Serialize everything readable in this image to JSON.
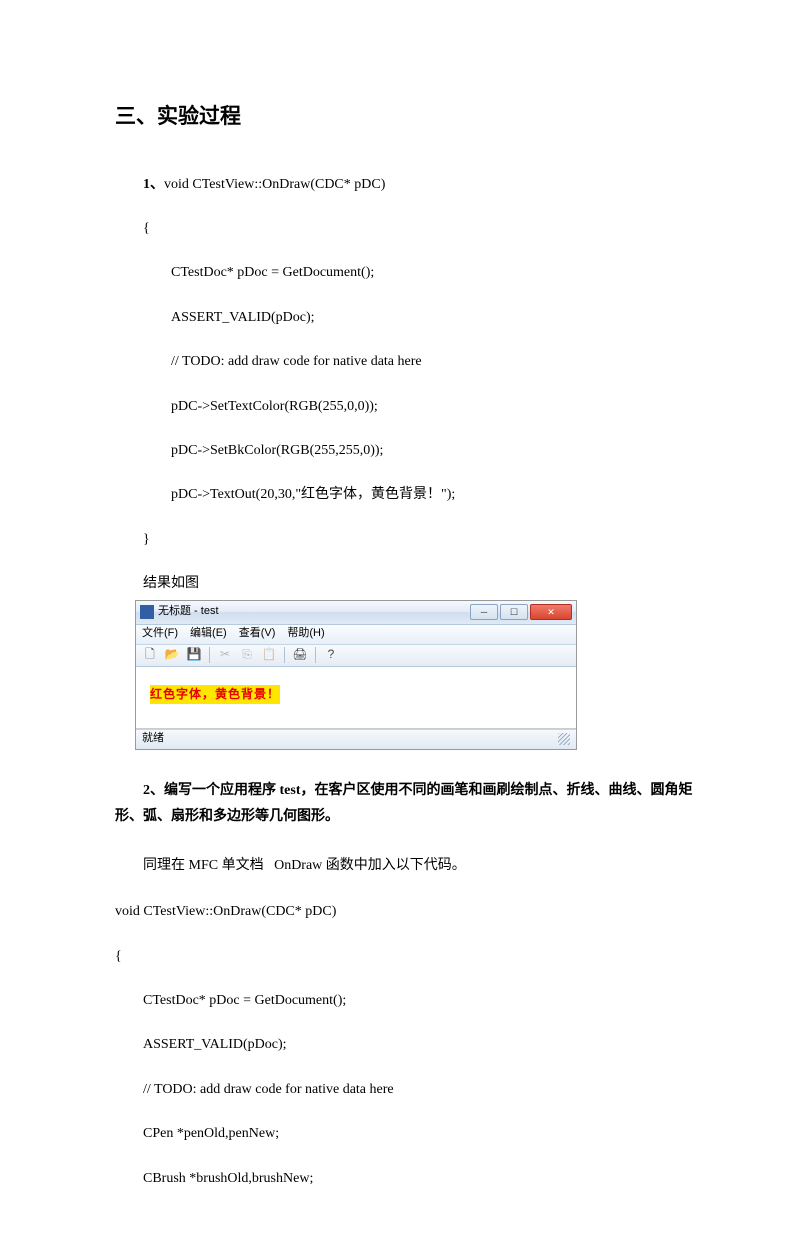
{
  "heading": "三、实验过程",
  "sec1": {
    "label": "1、",
    "sig": "void CTestView::OnDraw(CDC* pDC)",
    "open": "{",
    "l1": "CTestDoc* pDoc = GetDocument();",
    "l2": "ASSERT_VALID(pDoc);",
    "l3": "// TODO: add draw code for native data here",
    "l4": "pDC->SetTextColor(RGB(255,0,0));",
    "l5": "pDC->SetBkColor(RGB(255,255,0));",
    "l6": "pDC->TextOut(20,30,\"红色字体，黄色背景！\");",
    "close": "}",
    "result": "结果如图"
  },
  "win": {
    "title": "无标题 - test",
    "menus": {
      "file": "文件(F)",
      "edit": "编辑(E)",
      "view": "查看(V)",
      "help": "帮助(H)"
    },
    "output": "红色字体，黄色背景！",
    "status": "就绪"
  },
  "sec2": {
    "label": "2、",
    "desc": "编写一个应用程序 test，在客户区使用不同的画笔和画刷绘制点、折线、曲线、圆角矩形、弧、扇形和多边形等几何图形。",
    "note_prefix": "同理在 MFC 单文档",
    "note_suffix": "OnDraw 函数中加入以下代码。",
    "sig": " void CTestView::OnDraw(CDC* pDC)",
    "open": "{",
    "l1": "CTestDoc* pDoc = GetDocument();",
    "l2": "ASSERT_VALID(pDoc);",
    "l3": "// TODO: add draw code for native data here",
    "l4": "CPen *penOld,penNew;",
    "l5": "CBrush *brushOld,brushNew;"
  }
}
